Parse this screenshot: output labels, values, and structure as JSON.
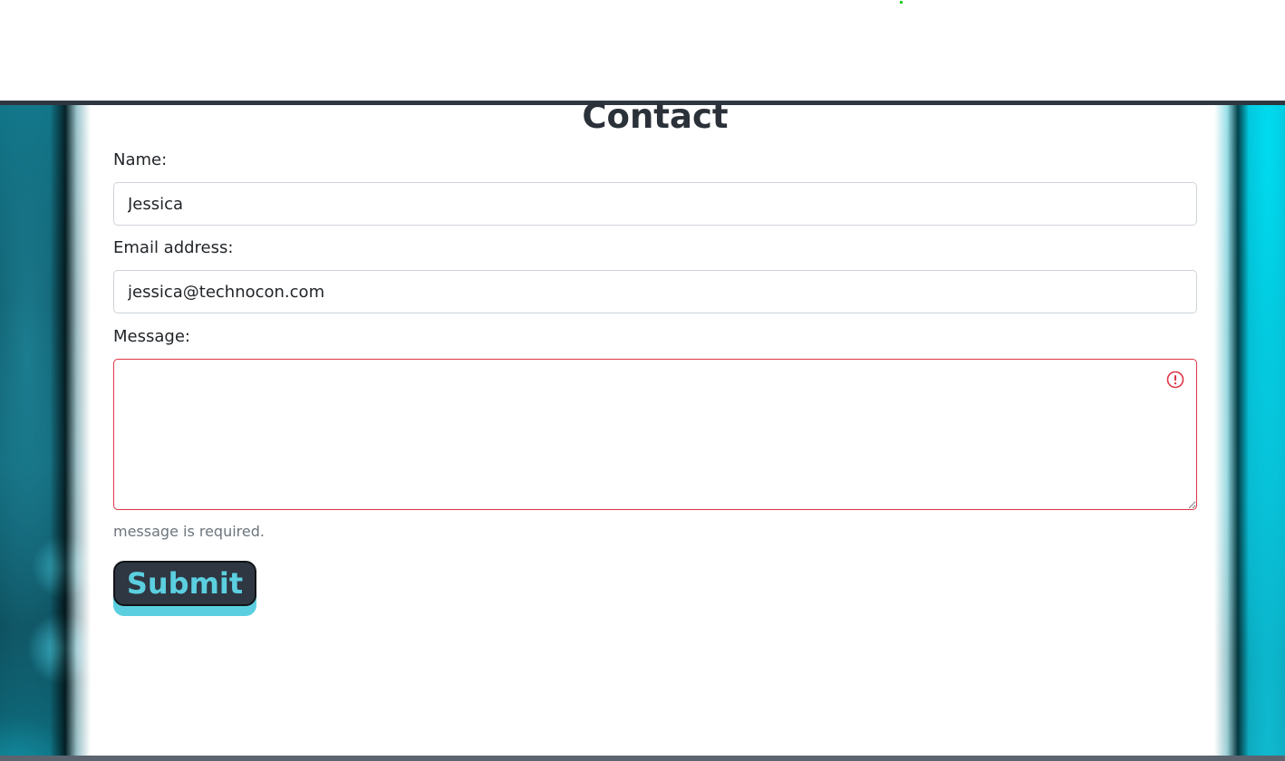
{
  "page": {
    "title": "Contact"
  },
  "form": {
    "name_label": "Name:",
    "name_value": "Jessica",
    "email_label": "Email address:",
    "email_value": "jessica@technocon.com",
    "message_label": "Message:",
    "message_value": "",
    "message_error": "message is required.",
    "submit_label": "Submit"
  },
  "icons": {
    "invalid": "exclamation-circle-icon"
  },
  "colors": {
    "error": "#dc3545",
    "button_bg": "#2f3742",
    "button_text": "#5bcfdf",
    "accent": "#5bcfdf",
    "help_text": "#6c757d"
  }
}
